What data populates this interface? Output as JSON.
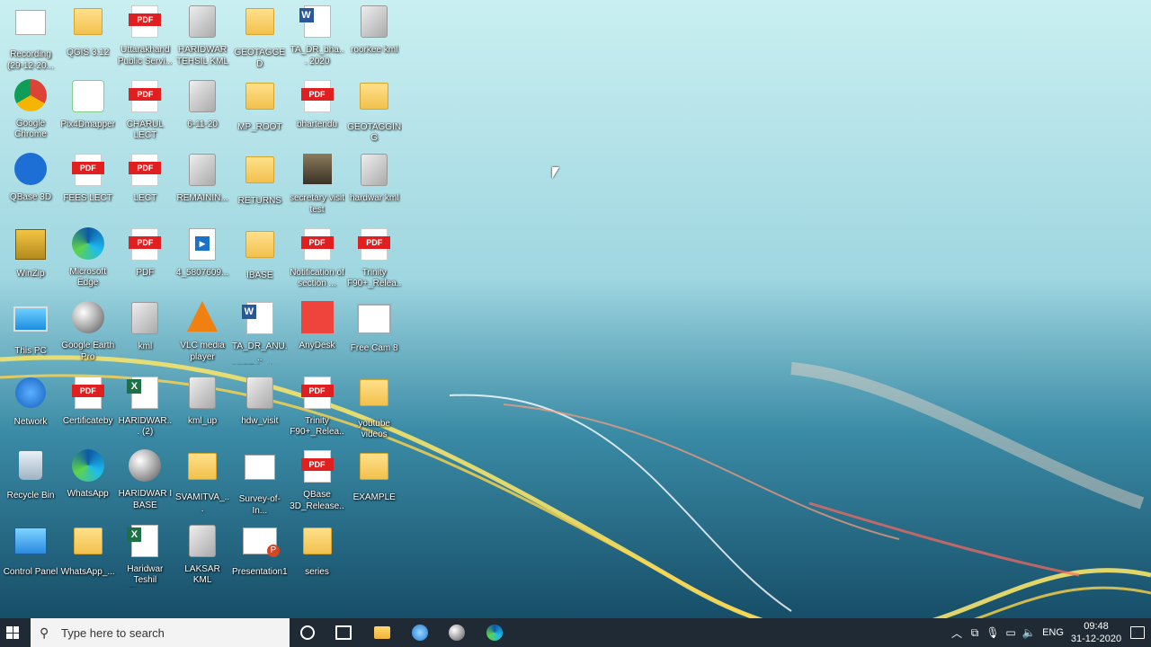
{
  "desktop": {
    "icons": [
      {
        "label": "Recording (29-12-20...",
        "kind": "g-doc"
      },
      {
        "label": "QGIS 3.12",
        "kind": "g-folder"
      },
      {
        "label": "Uttarakhand Public Servi...",
        "kind": "g-pdf"
      },
      {
        "label": "HARIDWAR TEHSIL KML",
        "kind": "g-kml"
      },
      {
        "label": "GEOTAGGED",
        "kind": "g-folder"
      },
      {
        "label": "TA_DR_bha... 2020",
        "kind": "g-word"
      },
      {
        "label": "roorkee kml",
        "kind": "g-kml"
      },
      {
        "label": "Google Chrome",
        "kind": "g-circle g-chrome"
      },
      {
        "label": "Pix4Dmapper",
        "kind": "g-pix4d"
      },
      {
        "label": "CHARUL LECT",
        "kind": "g-pdf"
      },
      {
        "label": "6-11-20",
        "kind": "g-kml"
      },
      {
        "label": "MP_ROOT",
        "kind": "g-folder"
      },
      {
        "label": "bhartendu",
        "kind": "g-pdf"
      },
      {
        "label": "GEOTAGGING",
        "kind": "g-folder"
      },
      {
        "label": "QBase 3D",
        "kind": "g-circle g-qbase"
      },
      {
        "label": "FEES LECT",
        "kind": "g-pdf"
      },
      {
        "label": "LECT",
        "kind": "g-pdf"
      },
      {
        "label": "REMAININ...",
        "kind": "g-kml"
      },
      {
        "label": "RETURNS",
        "kind": "g-folder"
      },
      {
        "label": "secretary visit test",
        "kind": "g-image"
      },
      {
        "label": "hardwar kml",
        "kind": "g-kml"
      },
      {
        "label": "WinZip",
        "kind": "g-winzip"
      },
      {
        "label": "Microsoft Edge",
        "kind": "g-circle g-edge"
      },
      {
        "label": "PDF",
        "kind": "g-pdf"
      },
      {
        "label": "4_5807609...",
        "kind": "g-video"
      },
      {
        "label": "IBASE",
        "kind": "g-folder"
      },
      {
        "label": "Notification of section ...",
        "kind": "g-pdf"
      },
      {
        "label": "Trinity F90+_Relea...",
        "kind": "g-pdf"
      },
      {
        "label": "This PC",
        "kind": "g-pc"
      },
      {
        "label": "Google Earth Pro",
        "kind": "g-circle g-earth"
      },
      {
        "label": "kml",
        "kind": "g-kml"
      },
      {
        "label": "VLC media player",
        "kind": "g-vlc"
      },
      {
        "label": "TA_DR_ANU... MISRA_dro...",
        "kind": "g-word"
      },
      {
        "label": "AnyDesk",
        "kind": "g-anydesk"
      },
      {
        "label": "Free Cam 8",
        "kind": "g-freecam"
      },
      {
        "label": "Network",
        "kind": "g-network"
      },
      {
        "label": "Certificateby",
        "kind": "g-pdf"
      },
      {
        "label": "HARIDWAR... (2)",
        "kind": "g-excel"
      },
      {
        "label": "kml_up",
        "kind": "g-kml"
      },
      {
        "label": "hdw_visit",
        "kind": "g-kml"
      },
      {
        "label": "Trinity F90+_Relea...",
        "kind": "g-pdf"
      },
      {
        "label": "youtube videos",
        "kind": "g-folder"
      },
      {
        "label": "Recycle Bin",
        "kind": "g-bin"
      },
      {
        "label": "WhatsApp",
        "kind": "g-circle g-edge"
      },
      {
        "label": "HARIDWAR I BASE",
        "kind": "g-circle g-earth"
      },
      {
        "label": "SVAMITVA_...",
        "kind": "g-folder"
      },
      {
        "label": "Survey-of-In...",
        "kind": "g-doc"
      },
      {
        "label": "QBase 3D_Release...",
        "kind": "g-pdf"
      },
      {
        "label": "EXAMPLE",
        "kind": "g-folder"
      },
      {
        "label": "Control Panel",
        "kind": "g-cpanel"
      },
      {
        "label": "WhatsApp_...",
        "kind": "g-folder"
      },
      {
        "label": "Haridwar Teshil Status...",
        "kind": "g-excel"
      },
      {
        "label": "LAKSAR KML",
        "kind": "g-kml"
      },
      {
        "label": "Presentation1",
        "kind": "g-ppt"
      },
      {
        "label": "series",
        "kind": "g-folder"
      }
    ]
  },
  "taskbar": {
    "search_placeholder": "Type here to search",
    "pinned": [
      "cortana-icon",
      "task-view-icon",
      "file-explorer-icon",
      "search-app-icon",
      "google-earth-icon",
      "edge-icon"
    ],
    "language": "ENG",
    "time": "09:48",
    "date": "31-12-2020",
    "notification_count": "1"
  }
}
